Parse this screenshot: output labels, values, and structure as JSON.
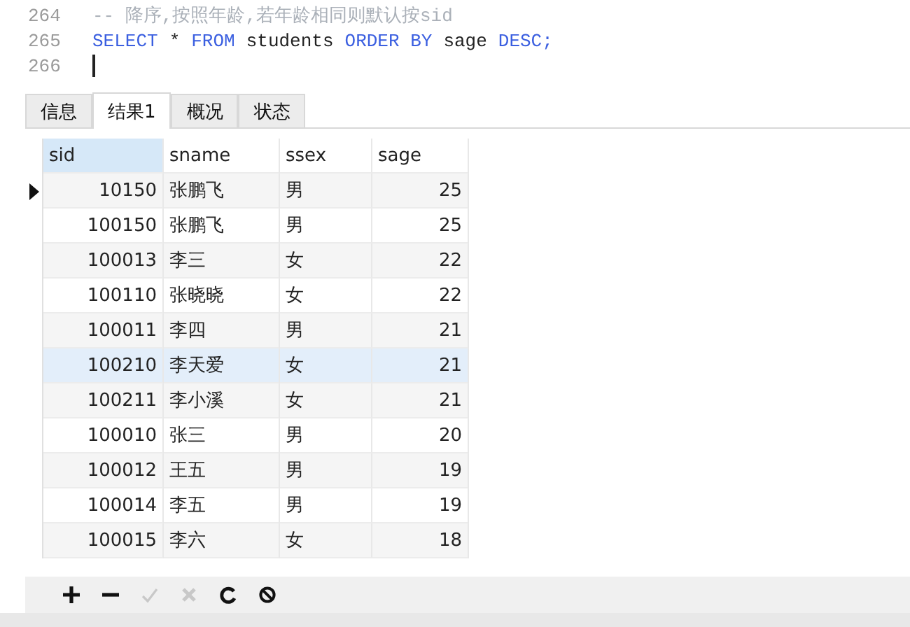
{
  "editor": {
    "lines": [
      {
        "number": "264",
        "tokens": [
          {
            "text": "-- 降序,按照年龄,若年龄相同则默认按sid",
            "kind": "comment"
          }
        ]
      },
      {
        "number": "265",
        "tokens": [
          {
            "text": "SELECT",
            "kind": "keyword"
          },
          {
            "text": "*",
            "kind": "plain"
          },
          {
            "text": "FROM",
            "kind": "keyword"
          },
          {
            "text": "students",
            "kind": "plain"
          },
          {
            "text": "ORDER BY",
            "kind": "keyword"
          },
          {
            "text": "sage",
            "kind": "plain"
          },
          {
            "text": "DESC;",
            "kind": "keyword"
          }
        ]
      },
      {
        "number": "266",
        "cursor": true
      }
    ]
  },
  "tabs": [
    {
      "label": "信息",
      "selected": false
    },
    {
      "label": "结果1",
      "selected": true
    },
    {
      "label": "概况",
      "selected": false
    },
    {
      "label": "状态",
      "selected": false
    }
  ],
  "table": {
    "columns": [
      {
        "label": "sid",
        "selected": true
      },
      {
        "label": "sname",
        "selected": false
      },
      {
        "label": "ssex",
        "selected": false
      },
      {
        "label": "sage",
        "selected": false
      }
    ],
    "rows": [
      {
        "cells": [
          "10150",
          "张鹏飞",
          "男",
          "25"
        ],
        "current": true,
        "highlighted": false
      },
      {
        "cells": [
          "100150",
          "张鹏飞",
          "男",
          "25"
        ],
        "current": false,
        "highlighted": false
      },
      {
        "cells": [
          "100013",
          "李三",
          "女",
          "22"
        ],
        "current": false,
        "highlighted": false
      },
      {
        "cells": [
          "100110",
          "张晓晓",
          "女",
          "22"
        ],
        "current": false,
        "highlighted": false
      },
      {
        "cells": [
          "100011",
          "李四",
          "男",
          "21"
        ],
        "current": false,
        "highlighted": false
      },
      {
        "cells": [
          "100210",
          "李天爱",
          "女",
          "21"
        ],
        "current": false,
        "highlighted": true
      },
      {
        "cells": [
          "100211",
          "李小溪",
          "女",
          "21"
        ],
        "current": false,
        "highlighted": false
      },
      {
        "cells": [
          "100010",
          "张三",
          "男",
          "20"
        ],
        "current": false,
        "highlighted": false
      },
      {
        "cells": [
          "100012",
          "王五",
          "男",
          "19"
        ],
        "current": false,
        "highlighted": false
      },
      {
        "cells": [
          "100014",
          "李五",
          "男",
          "19"
        ],
        "current": false,
        "highlighted": false
      },
      {
        "cells": [
          "100015",
          "李六",
          "女",
          "18"
        ],
        "current": false,
        "highlighted": false
      }
    ]
  },
  "toolbar": [
    {
      "kind": "add",
      "disabled": false
    },
    {
      "kind": "delete",
      "disabled": false
    },
    {
      "kind": "apply",
      "disabled": true
    },
    {
      "kind": "discard",
      "disabled": true
    },
    {
      "kind": "refresh",
      "disabled": false
    },
    {
      "kind": "stop",
      "disabled": false
    }
  ]
}
